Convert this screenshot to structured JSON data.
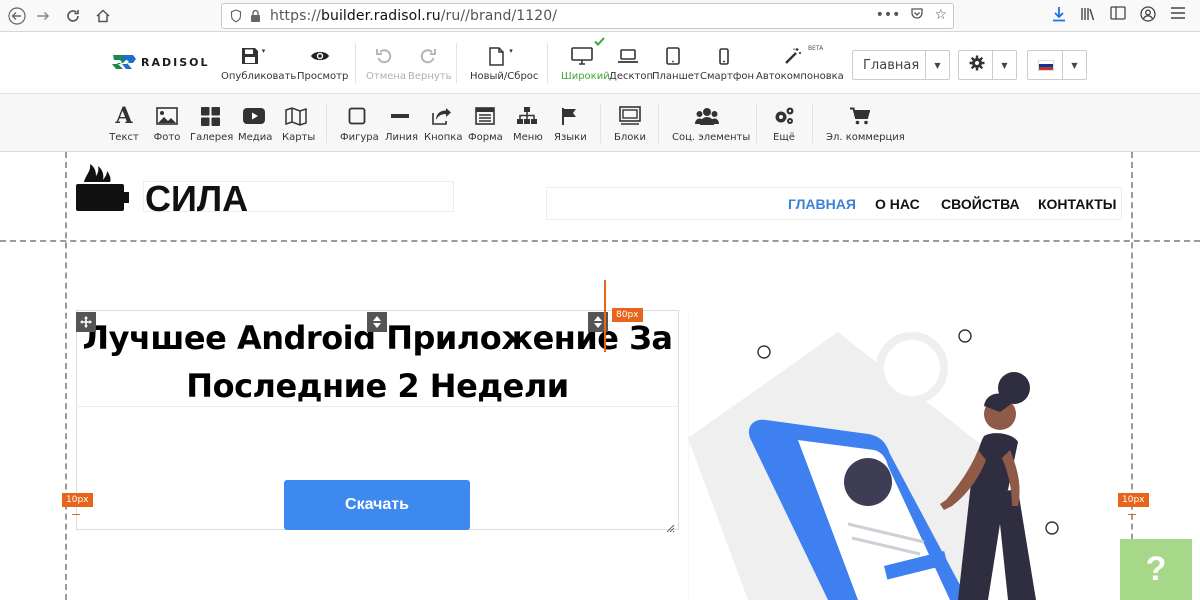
{
  "browser": {
    "url_host": "builder.radisol.ru",
    "url_path": "/ru//brand/1120/",
    "url_prefix": "https://"
  },
  "logo": {
    "text": "RADISOL"
  },
  "toolbar": {
    "publish": "Опубликовать",
    "preview": "Просмотр",
    "undo": "Отмена",
    "redo": "Вернуть",
    "new_reset": "Новый/Сброс",
    "wide": "Широкий",
    "desktop": "Десктоп",
    "tablet": "Планшет",
    "phone": "Смартфон",
    "auto_layout": "Автокомпоновка",
    "beta": "BETA",
    "page_select": "Главная"
  },
  "elements": {
    "text": "Текст",
    "photo": "Фото",
    "gallery": "Галерея",
    "media": "Медиа",
    "maps": "Карты",
    "shape": "Фигура",
    "line": "Линия",
    "button": "Кнопка",
    "form": "Форма",
    "menu": "Меню",
    "languages": "Языки",
    "blocks": "Блоки",
    "social": "Соц. элементы",
    "more": "Ещё",
    "ecommerce": "Эл. коммерция"
  },
  "site": {
    "name": "СИЛА",
    "menu": [
      "ГЛАВНАЯ",
      "О НАС",
      "СВОЙСТВА",
      "КОНТАКТЫ"
    ],
    "hero_line1": "Лучшее Android Приложение За",
    "hero_line2": "Последние 2 Недели",
    "download": "Скачать"
  },
  "badges": {
    "top_padding": "80px",
    "left_padding": "10px",
    "right_padding": "10px"
  },
  "help": "?",
  "colors": {
    "accent": "#3e89f0",
    "active_green": "#3aa83a",
    "badge": "#e8641b",
    "help": "#a7d88a"
  }
}
